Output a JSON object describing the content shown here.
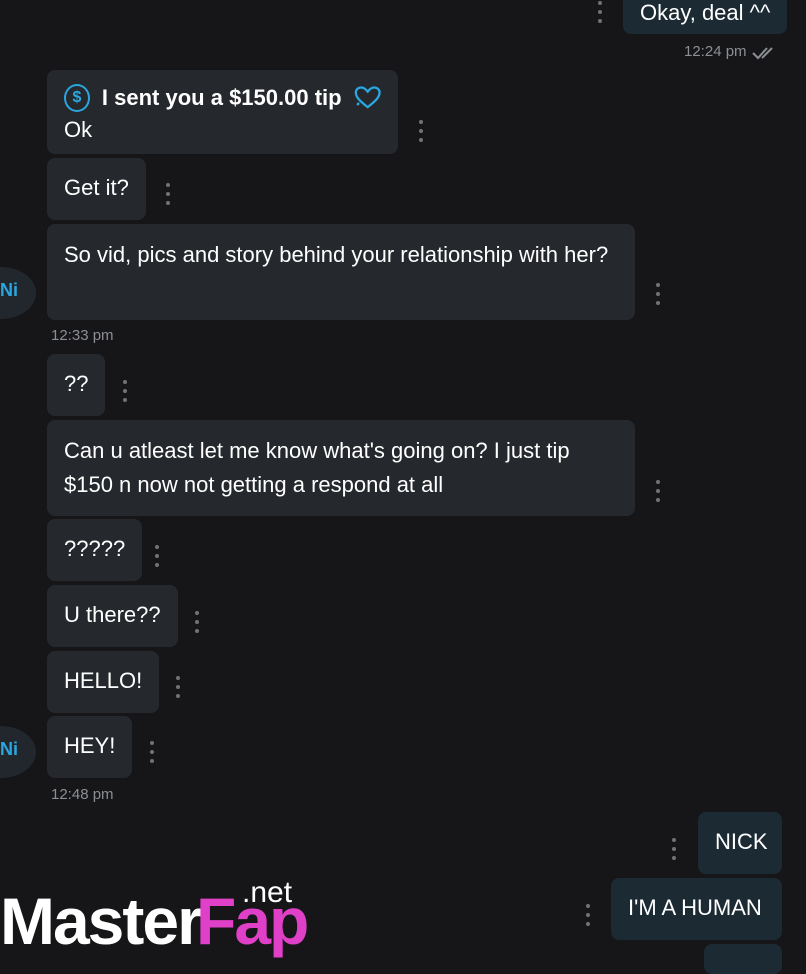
{
  "messages": {
    "okay_deal": "Okay, deal ^^",
    "time_1224": "12:24 pm",
    "tip_text": "I sent you a $150.00 tip",
    "ok": "Ok",
    "get_it": "Get it?",
    "vid_pics": "So vid, pics and story behind your relationship with her?",
    "time_1233": "12:33 pm",
    "qq": "??",
    "atleast": "Can u atleast let me know what's going on? I just tip $150 n now not getting a respond at all",
    "q5": "?????",
    "u_there": "U there??",
    "hello": "HELLO!",
    "hey": "HEY!",
    "time_1248": "12:48 pm",
    "nick": "NICK",
    "human": "I'M A HUMAN"
  },
  "avatar": {
    "initials": "Ni"
  },
  "icons": {
    "coin": "dollar-coin-icon",
    "heart": "heart-icon",
    "read": "double-check-icon",
    "more": "vertical-dots-icon"
  },
  "colors": {
    "background": "#161618",
    "incoming_bubble": "#25282d",
    "outgoing_bubble": "#1c2a34",
    "accent": "#2aa7e0",
    "logo_pink": "#e040c8"
  },
  "watermark": {
    "part1": "Master",
    "part2": "Fap",
    "part3": ".net"
  }
}
